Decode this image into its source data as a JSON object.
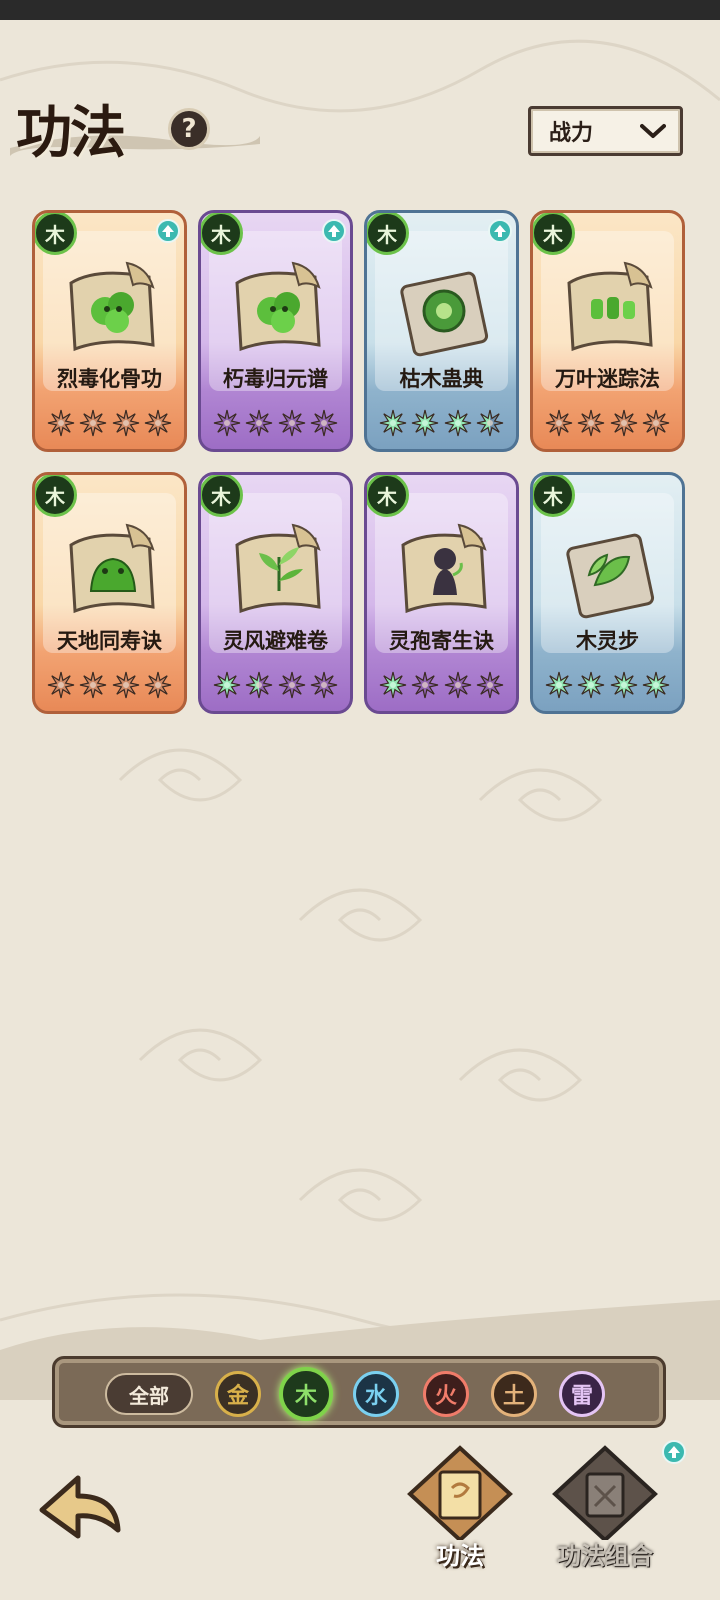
{
  "page": {
    "title": "功法",
    "help_icon": "question-mark-icon",
    "help_label": "?"
  },
  "sort": {
    "label": "战力",
    "icon": "chevron-down-icon"
  },
  "cards": [
    {
      "name": "烈毒化骨功",
      "element": "木",
      "rarity": "orange",
      "stars_filled": 0,
      "stars_total": 4,
      "upgrade": true,
      "art": "poison-cloud-scroll"
    },
    {
      "name": "朽毒归元谱",
      "element": "木",
      "rarity": "purple",
      "stars_filled": 0,
      "stars_total": 4,
      "upgrade": true,
      "art": "poison-cloud-scroll"
    },
    {
      "name": "枯木蛊典",
      "element": "木",
      "rarity": "blue",
      "stars_filled": 3.5,
      "stars_total": 4,
      "upgrade": true,
      "art": "green-orb-book"
    },
    {
      "name": "万叶迷踪法",
      "element": "木",
      "rarity": "orange",
      "stars_filled": 0,
      "stars_total": 4,
      "upgrade": false,
      "art": "leaf-figures-scroll"
    },
    {
      "name": "天地同寿诀",
      "element": "木",
      "rarity": "orange",
      "stars_filled": 0,
      "stars_total": 4,
      "upgrade": false,
      "art": "green-beast-scroll"
    },
    {
      "name": "灵风避难卷",
      "element": "木",
      "rarity": "purple",
      "stars_filled": 1.5,
      "stars_total": 4,
      "upgrade": false,
      "art": "leaf-scroll"
    },
    {
      "name": "灵孢寄生诀",
      "element": "木",
      "rarity": "purple",
      "stars_filled": 1,
      "stars_total": 4,
      "upgrade": false,
      "art": "shadow-figure-scroll"
    },
    {
      "name": "木灵步",
      "element": "木",
      "rarity": "blue",
      "stars_filled": 4,
      "stars_total": 4,
      "upgrade": false,
      "art": "leaf-book"
    }
  ],
  "filters": {
    "all_label": "全部",
    "elements": [
      {
        "label": "金",
        "color": "#d8b04a",
        "bg": "#3b3024",
        "selected": false
      },
      {
        "label": "木",
        "color": "#8ee06a",
        "bg": "#1e3a1c",
        "selected": true
      },
      {
        "label": "水",
        "color": "#7ad0f0",
        "bg": "#1c3446",
        "selected": false
      },
      {
        "label": "火",
        "color": "#f07c6a",
        "bg": "#3e1e1c",
        "selected": false
      },
      {
        "label": "土",
        "color": "#e3b27a",
        "bg": "#3d2a1c",
        "selected": false
      },
      {
        "label": "雷",
        "color": "#e4c4f4",
        "bg": "#3a2446",
        "selected": false
      }
    ]
  },
  "bottom_nav": {
    "back_icon": "back-arrow-icon",
    "tabs": [
      {
        "label": "功法",
        "icon": "technique-scroll-icon",
        "active": true
      },
      {
        "label": "功法组合",
        "icon": "technique-combo-icon",
        "active": false,
        "upgrade": true
      }
    ]
  },
  "colors": {
    "orange_card": "#f2a372",
    "purple_card": "#b186d3",
    "blue_card": "#8fb3cc",
    "wood_green": "#6cc24a",
    "star_active": "#8fe0b0",
    "star_empty_orange": "#c97f60",
    "star_empty_purple": "#8a5ea8",
    "star_empty_blue": "#6a8aa6"
  }
}
